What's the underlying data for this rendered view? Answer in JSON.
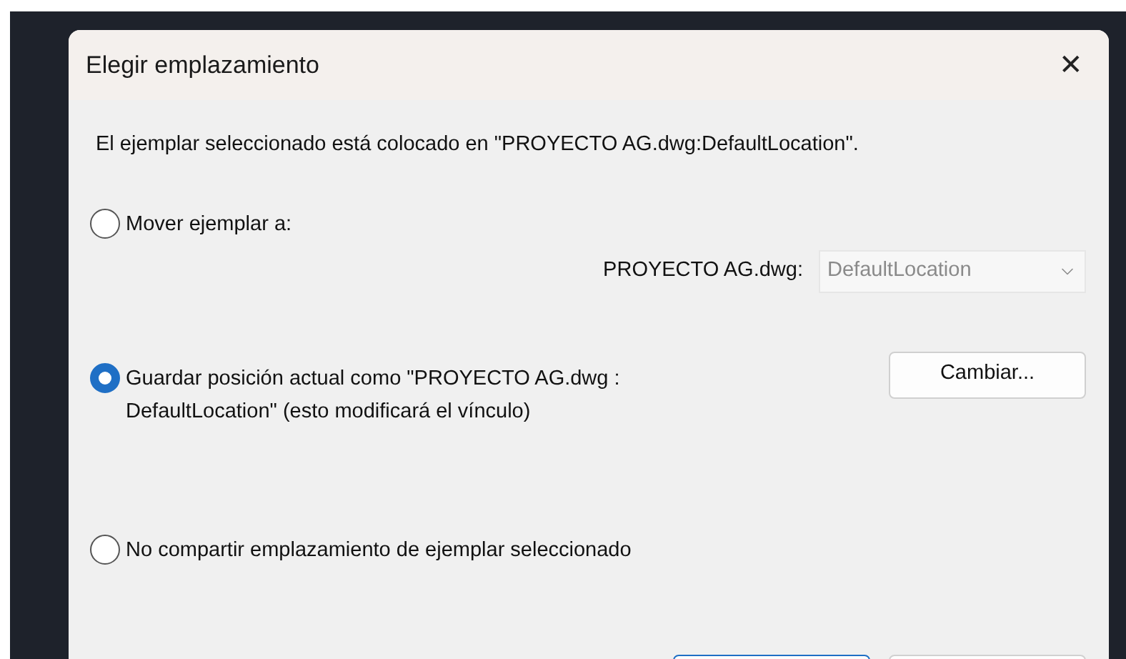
{
  "dialog": {
    "title": "Elegir emplazamiento",
    "close": "✕",
    "message": "El ejemplar seleccionado está colocado en \"PROYECTO AG.dwg:DefaultLocation\".",
    "options": [
      {
        "label": "Mover ejemplar a:",
        "selected": false,
        "file_label": "PROYECTO AG.dwg:",
        "dropdown": {
          "value": "DefaultLocation",
          "disabled": true
        }
      },
      {
        "label": "Guardar posición actual como \"PROYECTO AG.dwg : DefaultLocation\" (esto modificará el vínculo)",
        "selected": true,
        "button": "Cambiar..."
      },
      {
        "label": "No compartir emplazamiento de ejemplar seleccionado",
        "selected": false
      }
    ],
    "footer_buttons": [
      {
        "default": true
      },
      {
        "default": false
      }
    ]
  }
}
